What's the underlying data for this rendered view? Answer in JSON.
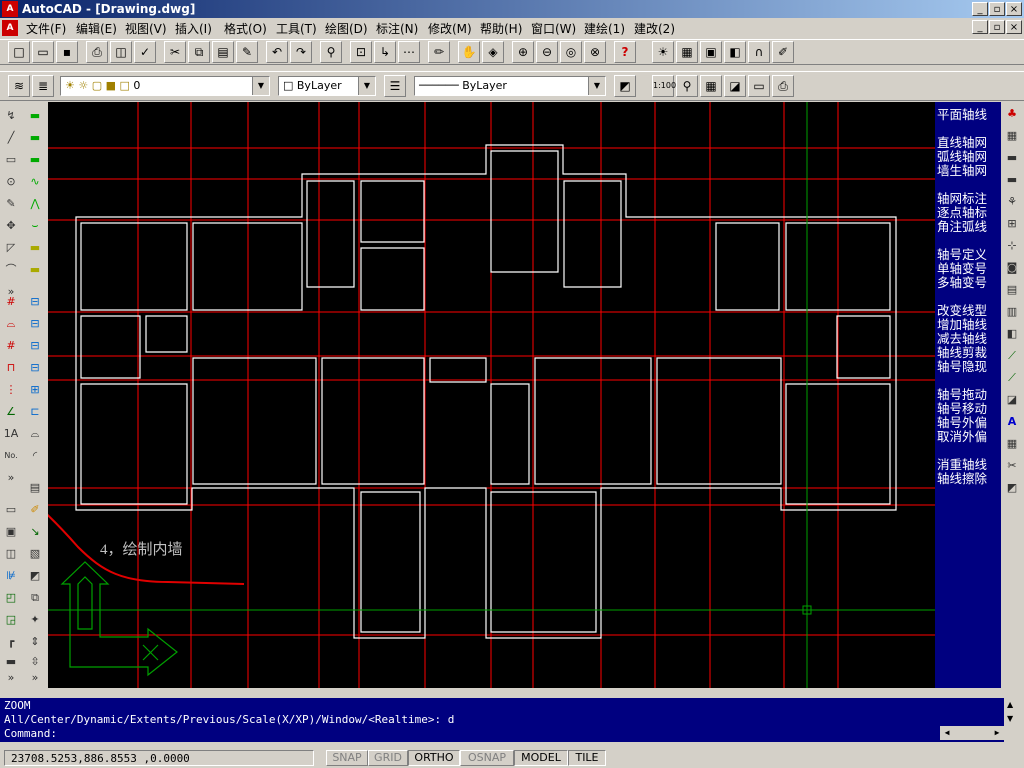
{
  "window": {
    "title": "AutoCAD - [Drawing.dwg]",
    "app_icon": "autocad-icon"
  },
  "menu": [
    "文件(F)",
    "编辑(E)",
    "视图(V)",
    "插入(I)",
    "格式(O)",
    "工具(T)",
    "绘图(D)",
    "标注(N)",
    "修改(M)",
    "帮助(H)",
    "窗口(W)",
    "建绘(1)",
    "建改(2)"
  ],
  "layer": {
    "current": "0",
    "color": "ByLayer",
    "linetype": "ByLayer"
  },
  "side_menu": {
    "title": "平面轴线",
    "items": [
      "直线轴网",
      "弧线轴网",
      "墙生轴网",
      "",
      "轴网标注",
      "逐点轴标",
      "角注弧线",
      "",
      "轴号定义",
      "单轴变号",
      "多轴变号",
      "",
      "改变线型",
      "增加轴线",
      "减去轴线",
      "轴线剪裁",
      "轴号隐现",
      "",
      "轴号拖动",
      "轴号移动",
      "轴号外偏",
      "取消外偏",
      "",
      "消重轴线",
      "轴线擦除"
    ]
  },
  "annotation": {
    "text": "4，绘制内墙"
  },
  "command": {
    "lines": [
      "ZOOM",
      "All/Center/Dynamic/Extents/Previous/Scale(X/XP)/Window/<Realtime>: d",
      "Command:"
    ]
  },
  "status": {
    "coords": "23708.5253,886.8553  ,0.0000",
    "toggles": [
      {
        "label": "SNAP",
        "active": false
      },
      {
        "label": "GRID",
        "active": false
      },
      {
        "label": "ORTHO",
        "active": true
      },
      {
        "label": "OSNAP",
        "active": false
      },
      {
        "label": "MODEL",
        "active": true
      },
      {
        "label": "TILE",
        "active": true
      }
    ]
  },
  "colors": {
    "canvas": "#000000",
    "axis": "#ff0000",
    "wall": "#ffffff",
    "crosshair": "#00a000",
    "side_menu": "#000080",
    "stroke": "#e00000"
  }
}
